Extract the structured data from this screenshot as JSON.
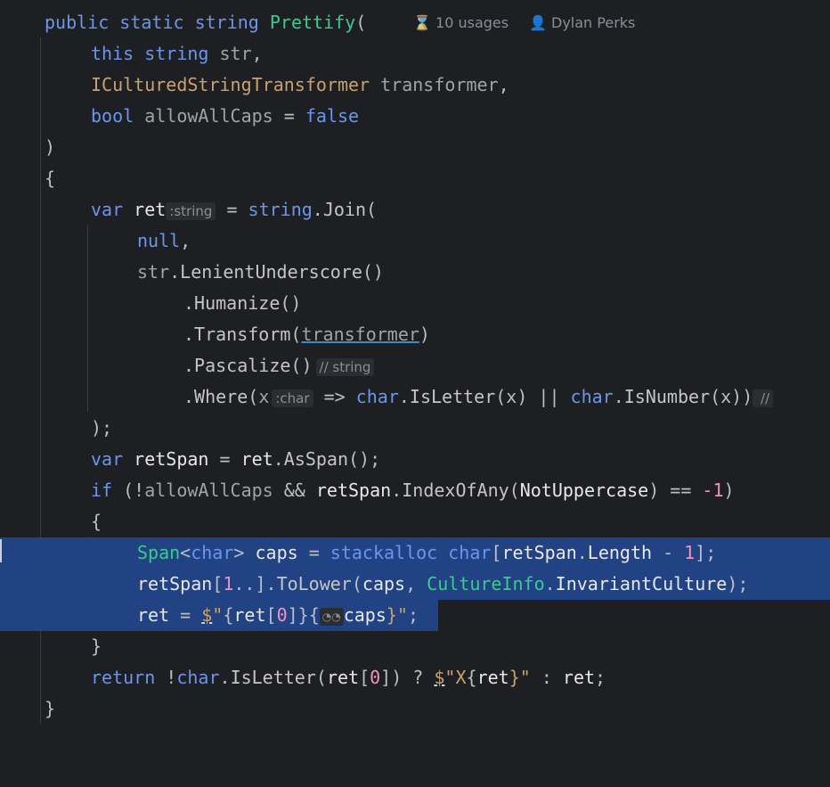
{
  "codelens": {
    "usages": "10 usages",
    "usages_icon": "hourglass-icon",
    "author": "Dylan Perks",
    "author_icon": "person-icon"
  },
  "code": {
    "l1": {
      "a": "public static ",
      "b": "string ",
      "c": "Prettify",
      "d": "("
    },
    "l2": {
      "a": "this ",
      "b": "string ",
      "c": "str",
      "d": ","
    },
    "l3": {
      "a": "ICulturedStringTransformer ",
      "b": "transformer",
      "c": ","
    },
    "l4": {
      "a": "bool ",
      "b": "allowAllCaps",
      "c": " = ",
      "d": "false"
    },
    "l5": ")",
    "l6": "{",
    "l7": {
      "a": "var ",
      "b": "ret",
      "hint": ":string",
      "c": " = ",
      "d": "string",
      ".": ".",
      "e": "Join",
      "f": "("
    },
    "l8": {
      "a": "null",
      "b": ","
    },
    "l9": {
      "a": "str",
      "b": ".",
      "c": "LenientUnderscore",
      "d": "()"
    },
    "l10": {
      "a": ".",
      "b": "Humanize",
      "c": "()"
    },
    "l11": {
      "a": ".",
      "b": "Transform",
      "c": "(",
      "d": "transformer",
      "e": ")"
    },
    "l12": {
      "a": ".",
      "b": "Pascalize",
      "c": "()",
      "hint": "// string"
    },
    "l13": {
      "a": ".",
      "b": "Where",
      "c": "(",
      "d": "x",
      "hint": ":char",
      "e": " => ",
      "f": "char",
      ".": ".",
      "g": "IsLetter",
      "h": "(x) || ",
      "i": "char",
      "j": ".",
      "k": "IsNumber",
      "l": "(x))",
      "m": " //"
    },
    "l14": ");",
    "l15": {
      "a": "var ",
      "b": "retSpan",
      "c": " = ",
      "d": "ret",
      ".": ".",
      "e": "AsSpan",
      "f": "();"
    },
    "l16": {
      "a": "if ",
      "b": "(!",
      "c": "allowAllCaps",
      "d": " && ",
      "e": "retSpan",
      ".": ".",
      "f": "IndexOfAny",
      "g": "(",
      "h": "NotUppercase",
      "i": ") == ",
      "j": "-1",
      ")": ")"
    },
    "l17": "{",
    "l18": {
      "a": "Span",
      "b": "<",
      "c": "char",
      "d": "> ",
      "e": "caps",
      "f": " = ",
      "g": "stackalloc ",
      "h": "char",
      "i": "[",
      "j": "retSpan",
      ".": ".",
      "k": "Length",
      "l": " - ",
      "m": "1",
      "n": "];"
    },
    "l19": {
      "a": "retSpan",
      "b": "[",
      "c": "1",
      "d": "..].",
      "e": "ToLower",
      "f": "(",
      "g": "caps",
      "h": ", ",
      "i": "CultureInfo",
      ".": ".",
      "j": "InvariantCulture",
      "k": ");"
    },
    "l20": {
      "a": "ret",
      "b": " = ",
      "c": "$",
      "d": "\"",
      "e": "{",
      "f": "ret",
      "g": "[",
      "h": "0",
      "i": "]}{",
      "icon": "glasses-icon",
      "j": "caps",
      "k": "}\"",
      "l": ";"
    },
    "l21": "}",
    "l22": {
      "a": "return ",
      "b": "!",
      "c": "char",
      ".": ".",
      "d": "IsLetter",
      "e": "(",
      "f": "ret",
      "g": "[",
      "h": "0",
      "i": "]) ? ",
      "j": "$",
      "k": "\"X",
      "l": "{",
      "m": "ret",
      "n": "}\"",
      "o": " : ",
      "p": "ret",
      "q": ";"
    },
    "l23": "}"
  }
}
